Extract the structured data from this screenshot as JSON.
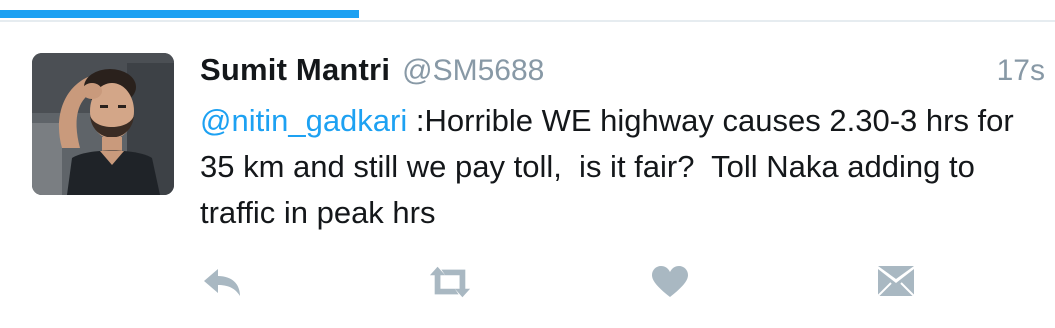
{
  "progress": {
    "fraction": 0.34
  },
  "tweet": {
    "display_name": "Sumit Mantri",
    "handle": "@SM5688",
    "timestamp": "17s",
    "mention": "@nitin_gadkari",
    "text": " :Horrible WE highway causes 2.30-3 hrs for 35 km and still we pay toll,  is it fair?  Toll Naka adding to traffic in peak hrs"
  },
  "actions": {
    "reply_icon": "reply-icon",
    "retweet_icon": "retweet-icon",
    "like_icon": "heart-icon",
    "dm_icon": "envelope-icon"
  },
  "colors": {
    "accent": "#1da1f2",
    "icon_gray": "#a9b8c2",
    "text": "#14171a",
    "muted": "#8899a6"
  }
}
